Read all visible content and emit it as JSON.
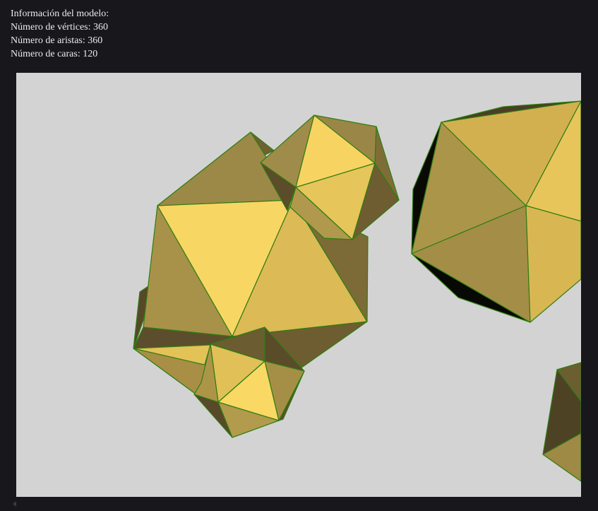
{
  "model_info": {
    "title": "Información del modelo:",
    "vertices_label": "Número de vértices: 360",
    "edges_label": "Número de aristas: 360",
    "faces_label": "Número de caras: 120"
  },
  "scene": {
    "background_color": "#d3d3d3",
    "edge_color": "#2f7d12",
    "face_color": "#d9b84f",
    "object_count": 5
  },
  "scrollbar": {
    "left_arrow_icon": "triangle-left-icon"
  }
}
